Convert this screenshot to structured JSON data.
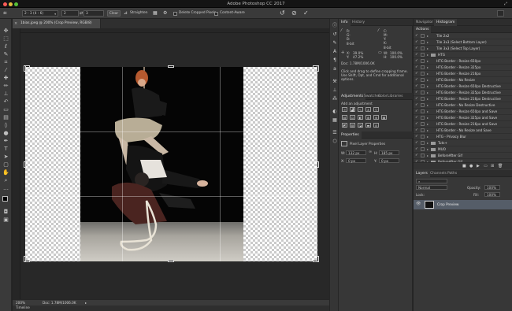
{
  "window": {
    "title": "Adobe Photoshop CC 2017"
  },
  "options_bar": {
    "ratio_label": "2 : 3 (4 : 6)",
    "ratio_w": "2",
    "ratio_h": "3",
    "clear_label": "Clear",
    "straighten_label": "Straighten",
    "delete_cropped_label": "Delete Cropped Pixels",
    "content_aware_label": "Content-Aware"
  },
  "document": {
    "tab_label": "1bias.jpeg @ 200% (Crop Preview, RGB/8)"
  },
  "status_bar": {
    "zoom": "200%",
    "doc_size": "Doc: 1.78M/1006.0K"
  },
  "bottom_tab": {
    "label": "Timeline"
  },
  "info_panel": {
    "tabs": [
      "Info",
      "History"
    ],
    "r_label": "R:",
    "g_label": "G:",
    "b_label": "B:",
    "c_label": "C:",
    "m_label": "M:",
    "y_label": "Y:",
    "k_label": "K:",
    "bit_left": "8-bit",
    "bit_right": "8-bit",
    "x_label": "X:",
    "y2_label": "Y:",
    "w_label": "W:",
    "h_label": "H:",
    "x_value": "39.0%",
    "y_value": "47.2%",
    "w_value": "100.0%",
    "h_value": "100.0%",
    "doc": "Doc: 1.78M/1006.0K",
    "hint": "Click and drag to define cropping frame. Use Shift, Opt, and Cmd for additional options."
  },
  "adjustments_panel": {
    "tabs": [
      "Adjustments",
      "Swatches",
      "Color",
      "Libraries"
    ],
    "add_label": "Add an adjustment"
  },
  "properties_panel": {
    "title": "Properties",
    "layer_label": "Pixel Layer Properties",
    "w_label": "W:",
    "w_value": "132 px",
    "h_label": "H:",
    "h_value": "185 px",
    "x_label": "X:",
    "x_value": "0 px",
    "y_label": "Y:",
    "y_value": "0 px"
  },
  "navigator_panel": {
    "tabs": [
      "Navigator",
      "Histogram"
    ]
  },
  "actions_panel": {
    "title": "Actions",
    "items": [
      "Tile 2x2",
      "Tile 3x3 (Select Bottom Layer)",
      "Tile 3x3 (Select Top Layer)",
      "HTG",
      "HTG Border - Resize 650px",
      "HTG Border - Resize 325px",
      "HTG Border - Resize 216px",
      "HTG Border - No Resize",
      "HTG Border - Resize 650px Destructive",
      "HTG Border - Resize 325px Destructive",
      "HTG Border - Resize 216px Destructive",
      "HTG Border - No Resize Destructive",
      "HTG Border - Resize 650px and Save",
      "HTG Border - Resize 325px and Save",
      "HTG Border - Resize 216px and Save",
      "HTG Border - No Resize and Save",
      "HTG - Privacy Blur",
      "Tuts+",
      "MUO",
      "BeforeAfter Gif",
      "BeforeAfter Gif"
    ]
  },
  "layers_panel": {
    "tabs": [
      "Layers",
      "Channels",
      "Paths"
    ],
    "blend_mode": "Normal",
    "opacity_label": "Opacity:",
    "opacity_value": "100%",
    "lock_label": "Lock:",
    "fill_label": "Fill:",
    "fill_value": "100%",
    "layer_name": "Crop Preview"
  }
}
